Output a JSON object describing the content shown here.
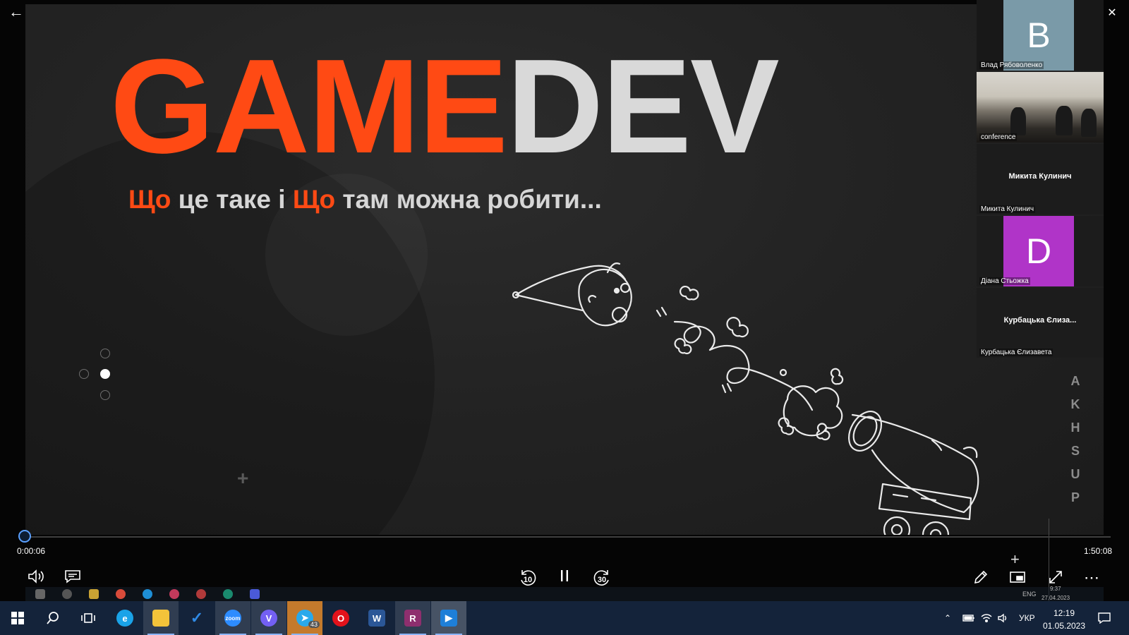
{
  "slide": {
    "title_game": "GAME",
    "title_dev": "DEV",
    "subtitle_part1": "Що",
    "subtitle_part2": " це таке і ",
    "subtitle_part3": "Що",
    "subtitle_part4": " там можна робити...",
    "side_text": [
      "P",
      "U",
      "S",
      "H",
      "K",
      "A"
    ]
  },
  "participants": [
    {
      "type": "avatar",
      "letter": "B",
      "color": "#7a9aa8",
      "name": "Влад Рябоволенко"
    },
    {
      "type": "video",
      "name": "conference"
    },
    {
      "type": "name",
      "display": "Микита Кулинич",
      "name": "Микита Кулинич"
    },
    {
      "type": "avatar",
      "letter": "D",
      "color": "#b034c8",
      "name": "Діана Стьожка"
    },
    {
      "type": "name",
      "display": "Курбацька Єлиза...",
      "name": "Курбацька Єлизавета"
    }
  ],
  "player": {
    "current_time": "0:00:06",
    "total_time": "1:50:08",
    "skip_back": "10",
    "skip_forward": "30",
    "progress_fraction": 0.0009
  },
  "inner_taskbar": {
    "tray_lang": "ENG",
    "tray_time": "9:37",
    "tray_date": "27.04.2023"
  },
  "taskbar": {
    "apps": [
      {
        "name": "edge",
        "color": "#1aa3e8",
        "label": "e"
      },
      {
        "name": "explorer",
        "color": "#f3c33a",
        "label": ""
      },
      {
        "name": "todo",
        "color": "#2f7ae5",
        "label": "✓"
      },
      {
        "name": "zoom",
        "color": "#2d8cff",
        "label": "zoom"
      },
      {
        "name": "viber",
        "color": "#7360f2",
        "label": "V"
      },
      {
        "name": "telegram",
        "color": "#29a9eb",
        "label": "➤"
      },
      {
        "name": "opera",
        "color": "#e3121b",
        "label": "O"
      },
      {
        "name": "word",
        "color": "#2b5797",
        "label": "W"
      },
      {
        "name": "winrar",
        "color": "#8e2f6e",
        "label": "R"
      },
      {
        "name": "video-player",
        "color": "#1e7fd8",
        "label": "▶"
      }
    ],
    "telegram_badge": "43",
    "lang": "УКР",
    "time": "12:19",
    "date": "01.05.2023"
  }
}
